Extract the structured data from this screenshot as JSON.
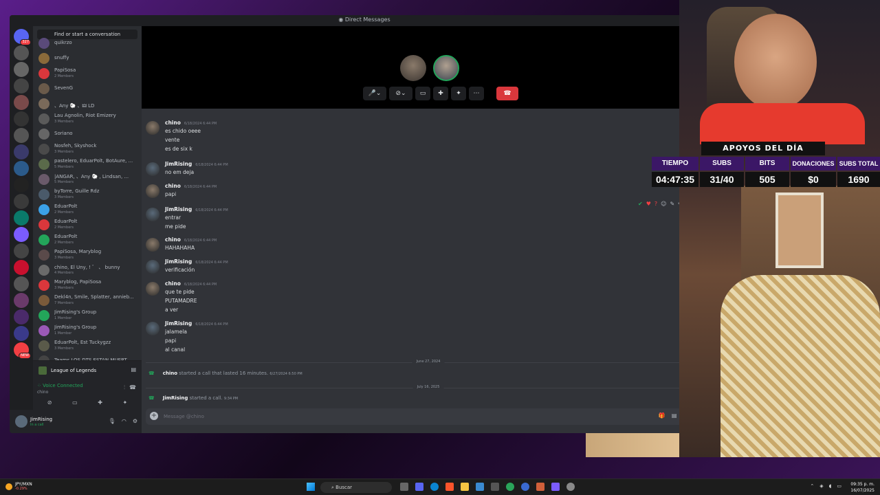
{
  "window": {
    "title": "Direct Messages"
  },
  "search": {
    "label": "Find or start a conversation"
  },
  "guilds": [
    {
      "badge": "327",
      "color": "#5865f2"
    },
    {
      "badge": "",
      "color": "#555"
    },
    {
      "badge": "",
      "color": "#666"
    },
    {
      "badge": "",
      "color": "#444"
    },
    {
      "badge": "",
      "color": "#7a4a4a"
    },
    {
      "badge": "",
      "color": "#333"
    },
    {
      "badge": "",
      "color": "#555"
    },
    {
      "badge": "",
      "color": "#3a3a6a"
    },
    {
      "badge": "",
      "color": "#2b5a8a"
    },
    {
      "badge": "",
      "color": "#222"
    },
    {
      "badge": "",
      "color": "#3a3a3a"
    },
    {
      "badge": "",
      "color": "#0a7a6a"
    },
    {
      "badge": "",
      "color": "#7b5cff"
    },
    {
      "badge": "",
      "color": "#444"
    },
    {
      "badge": "",
      "color": "#c8102e"
    },
    {
      "badge": "",
      "color": "#555"
    },
    {
      "badge": "",
      "color": "#6a3a6a"
    },
    {
      "badge": "",
      "color": "#4a2a6a"
    },
    {
      "badge": "",
      "color": "#3a3a8a"
    },
    {
      "badge": "NEW",
      "color": "#f23f43"
    }
  ],
  "dms": [
    {
      "name": "quikrzo",
      "sub": "",
      "color": "#5a4a7a"
    },
    {
      "name": "snuffy",
      "sub": "",
      "color": "#8a6a3a"
    },
    {
      "name": "PapiSosa",
      "sub": "2 Members",
      "color": "#da373c"
    },
    {
      "name": "SevenG",
      "sub": "",
      "color": "#6a5a4a"
    },
    {
      "name": "、Any 🐑 、🜲 LD",
      "sub": "",
      "color": "#7a6a5a"
    },
    {
      "name": "Lau Agnolin, Riot Emizery",
      "sub": "3 Members",
      "color": "#5a5a5a"
    },
    {
      "name": "Soriano",
      "sub": "",
      "color": "#666"
    },
    {
      "name": "Nosfeh, Skyshock",
      "sub": "3 Members",
      "color": "#4a4a4a"
    },
    {
      "name": "pastelero, EduarPolt, BotAure, ...",
      "sub": "5 Members",
      "color": "#5a6a4a"
    },
    {
      "name": "|ANGAR, 、Any 🐑 , Lindsan, ...",
      "sub": "5 Members",
      "color": "#6a5a6a"
    },
    {
      "name": "byTorre, Guille Rdz",
      "sub": "3 Members",
      "color": "#4a5a6a"
    },
    {
      "name": "EduarPolt",
      "sub": "2 Members",
      "color": "#3ba1e8"
    },
    {
      "name": "EduarPolt",
      "sub": "2 Members",
      "color": "#da373c"
    },
    {
      "name": "EduarPolt",
      "sub": "2 Members",
      "color": "#23a55a"
    },
    {
      "name": "PapiSosa, Maryblog",
      "sub": "3 Members",
      "color": "#5a4a4a"
    },
    {
      "name": "chino, El Uny, ! ゛ 、 bunny",
      "sub": "4 Members",
      "color": "#6a6a6a"
    },
    {
      "name": "Maryblog, PapiSosa",
      "sub": "3 Members",
      "color": "#da373c"
    },
    {
      "name": "Dekl4n, Smile, Splatter, annieb...",
      "sub": "7 Members",
      "color": "#7a5a3a"
    },
    {
      "name": "JimRising's Group",
      "sub": "1 Member",
      "color": "#23a55a"
    },
    {
      "name": "JimRising's Group",
      "sub": "1 Member",
      "color": "#9b59b6"
    },
    {
      "name": "EduarPolt, Est Tuckygzz",
      "sub": "3 Members",
      "color": "#5a5a4a"
    },
    {
      "name": "Teams LOS DTS ESTAN MUERT...",
      "sub": "",
      "color": "#444"
    }
  ],
  "voice": {
    "channel": "League of Legends",
    "status": "Voice Connected",
    "user": "chino"
  },
  "user": {
    "name": "JimRising",
    "status": "In a call"
  },
  "messages": [
    {
      "author": "chino",
      "ts": "6/18/2024 6:44 PM",
      "lines": [
        "es chido oeee",
        "vente",
        "es de six k"
      ],
      "color": "#8a7a6a"
    },
    {
      "author": "JimRising",
      "ts": "6/18/2024 6:44 PM",
      "lines": [
        "no em deja"
      ],
      "color": "#5a6a7a"
    },
    {
      "author": "chino",
      "ts": "6/18/2024 6:44 PM",
      "lines": [
        "papi"
      ],
      "color": "#8a7a6a"
    },
    {
      "author": "JimRising",
      "ts": "6/18/2024 6:44 PM",
      "lines": [
        "entrar",
        "me pide"
      ],
      "color": "#5a6a7a"
    },
    {
      "author": "chino",
      "ts": "6/18/2024 6:44 PM",
      "lines": [
        "HAHAHAHA"
      ],
      "color": "#8a7a6a"
    },
    {
      "author": "JimRising",
      "ts": "6/18/2024 6:44 PM",
      "lines": [
        "verificación"
      ],
      "color": "#5a6a7a"
    },
    {
      "author": "chino",
      "ts": "6/18/2024 6:44 PM",
      "lines": [
        "que te pide",
        "PUTAMADRE",
        "a ver"
      ],
      "color": "#8a7a6a"
    },
    {
      "author": "JimRising",
      "ts": "6/18/2024 6:44 PM",
      "lines": [
        "jalamela",
        "papi",
        "al canal"
      ],
      "color": "#5a6a7a"
    }
  ],
  "dividers": [
    "June 27, 2024",
    "July 16, 2025"
  ],
  "calls": [
    {
      "author": "chino",
      "text": "started a call that lasted 16 minutes.",
      "ts": "6/27/2024 6:50 PM"
    },
    {
      "author": "JimRising",
      "text": "started a call.",
      "ts": "9:34 PM"
    }
  ],
  "composer": {
    "placeholder": "Message @chino"
  },
  "stats": {
    "header": "APOYOS DEL DÍA",
    "labels": [
      "TIEMPO",
      "SUBS",
      "BITS",
      "DONACIONES",
      "SUBS TOTAL"
    ],
    "values": [
      "04:47:35",
      "31/40",
      "505",
      "$0",
      "1690"
    ]
  },
  "taskbar": {
    "ticker": "JPY/MXN",
    "ticker_change": "-0.29%",
    "search": "Buscar",
    "time": "09:35 p. m.",
    "date": "16/07/2025"
  }
}
